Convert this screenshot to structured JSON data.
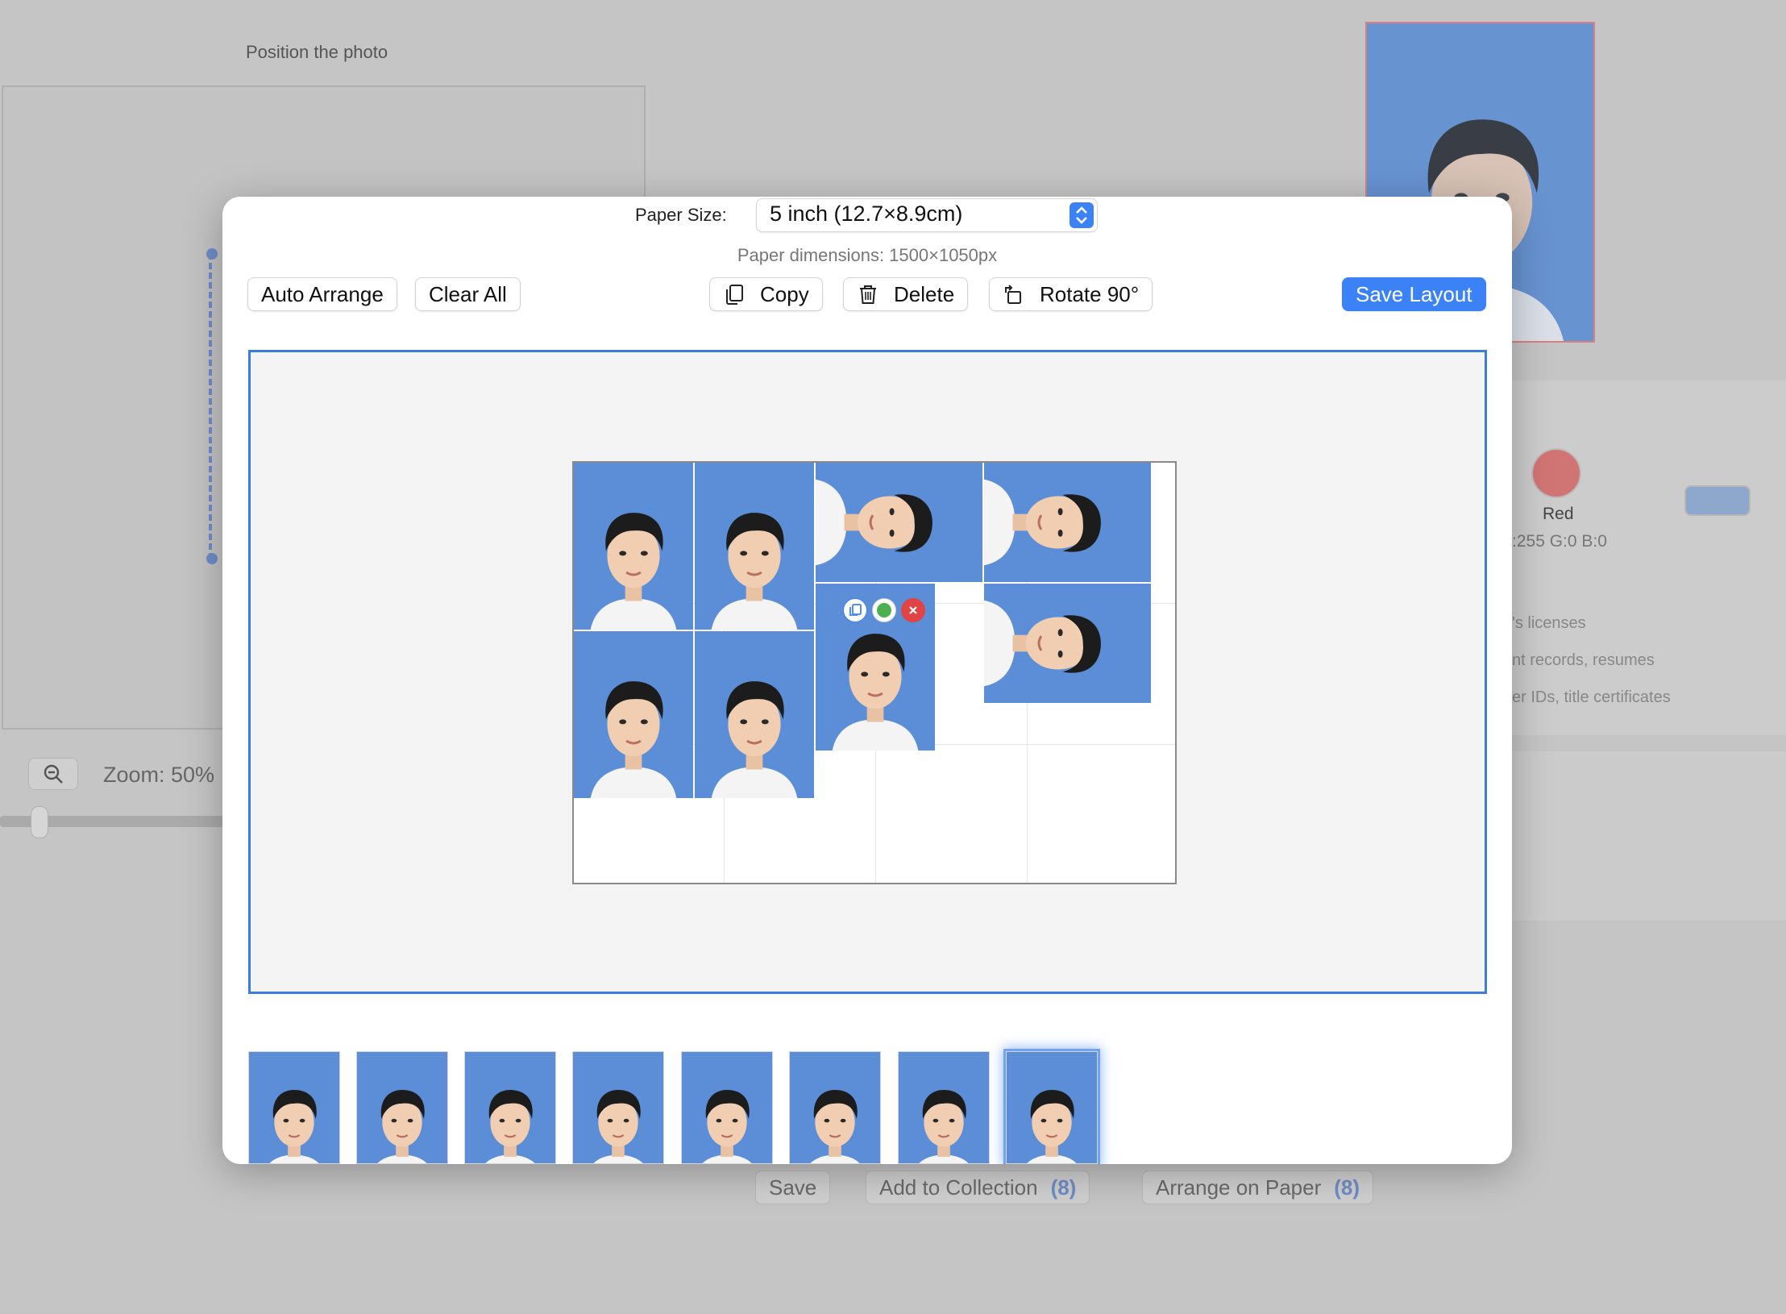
{
  "background": {
    "position_label": "Position the photo",
    "zoom_label": "Zoom: 50%",
    "color_name": "Red",
    "color_rgb": ":255 G:0 B:0",
    "list_items": [
      "'s licenses",
      "nt records, resumes",
      "er IDs, title certificates"
    ],
    "save_label": "Save",
    "add_collection_label": "Add to Collection",
    "add_collection_count": "(8)",
    "arrange_label": "Arrange on Paper",
    "arrange_count": "(8)"
  },
  "dialog": {
    "paper_size_label": "Paper Size:",
    "paper_size_value": "5 inch (12.7×8.9cm)",
    "paper_dimensions": "Paper dimensions: 1500×1050px",
    "toolbar": {
      "auto_arrange": "Auto Arrange",
      "clear_all": "Clear All",
      "copy": "Copy",
      "delete": "Delete",
      "rotate": "Rotate 90°",
      "save_layout": "Save Layout"
    },
    "photo_background_color": "#5b8ed6",
    "thumbnail_count": 8
  },
  "colors": {
    "accent": "#3b82f6",
    "canvas_border": "#3b7ddd",
    "photo_blue": "#5b8ed6",
    "delete_red": "#e04444",
    "green": "#4caf50"
  },
  "icons": [
    "zoom-out-icon",
    "updown-arrows-icon",
    "copy-icon",
    "trash-icon",
    "rotate-icon",
    "duplicate-icon",
    "green-dot-icon",
    "close-icon"
  ]
}
